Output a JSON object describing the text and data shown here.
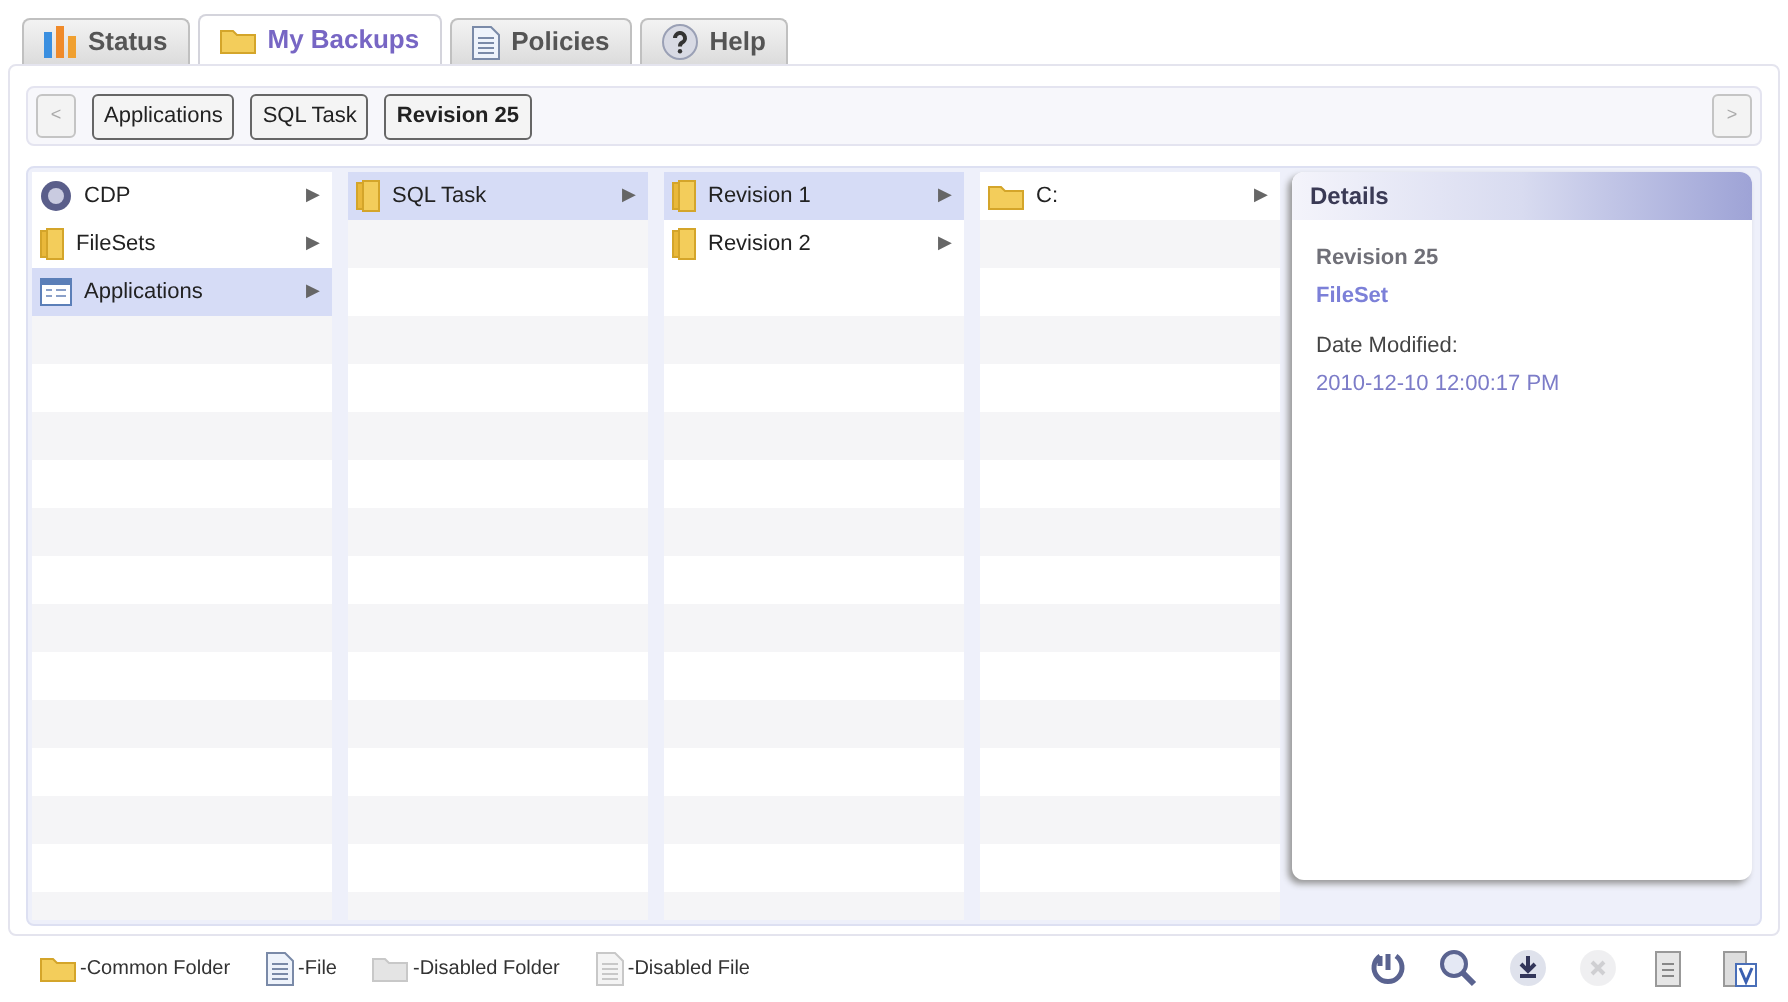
{
  "tabs": [
    {
      "label": "Status",
      "kind": "chart",
      "selected": false
    },
    {
      "label": "My Backups",
      "kind": "folder",
      "selected": true
    },
    {
      "label": "Policies",
      "kind": "document",
      "selected": false
    },
    {
      "label": "Help",
      "kind": "help",
      "selected": false
    }
  ],
  "breadcrumb": {
    "back": "<",
    "forward": ">",
    "items": [
      {
        "label": "Applications",
        "selected": false
      },
      {
        "label": "SQL Task",
        "selected": false
      },
      {
        "label": "Revision 25",
        "selected": true
      }
    ]
  },
  "columns": [
    [
      {
        "label": "CDP",
        "kind": "cdp",
        "selected": false,
        "arrow": "▶"
      },
      {
        "label": "FileSets",
        "kind": "folder",
        "selected": false,
        "arrow": "▶"
      },
      {
        "label": "Applications",
        "kind": "app",
        "selected": true,
        "arrow": "▶"
      }
    ],
    [
      {
        "label": "SQL Task",
        "kind": "folder",
        "selected": true,
        "arrow": "▶"
      }
    ],
    [
      {
        "label": "Revision 1",
        "kind": "folder",
        "selected": true,
        "arrow": "▶"
      },
      {
        "label": "Revision 2",
        "kind": "folder",
        "selected": false,
        "arrow": "▶"
      }
    ],
    [
      {
        "label": "C:",
        "kind": "drive",
        "selected": false,
        "arrow": "▶"
      }
    ]
  ],
  "details": {
    "title": "Details",
    "name": "Revision 25",
    "type": "FileSet",
    "date_label": "Date Modified:",
    "date": "2010-12-10 12:00:17 PM"
  },
  "legend": [
    {
      "kind": "folder",
      "label": "-Common Folder"
    },
    {
      "kind": "file",
      "label": "-File"
    },
    {
      "kind": "disabled-folder",
      "label": "-Disabled Folder"
    },
    {
      "kind": "disabled-file",
      "label": "-Disabled File"
    }
  ],
  "toolbar": [
    {
      "kind": "restore",
      "disabled": false
    },
    {
      "kind": "search",
      "disabled": false
    },
    {
      "kind": "download",
      "disabled": false
    },
    {
      "kind": "delete",
      "disabled": true
    },
    {
      "kind": "report",
      "disabled": false
    },
    {
      "kind": "verify",
      "disabled": false
    }
  ]
}
